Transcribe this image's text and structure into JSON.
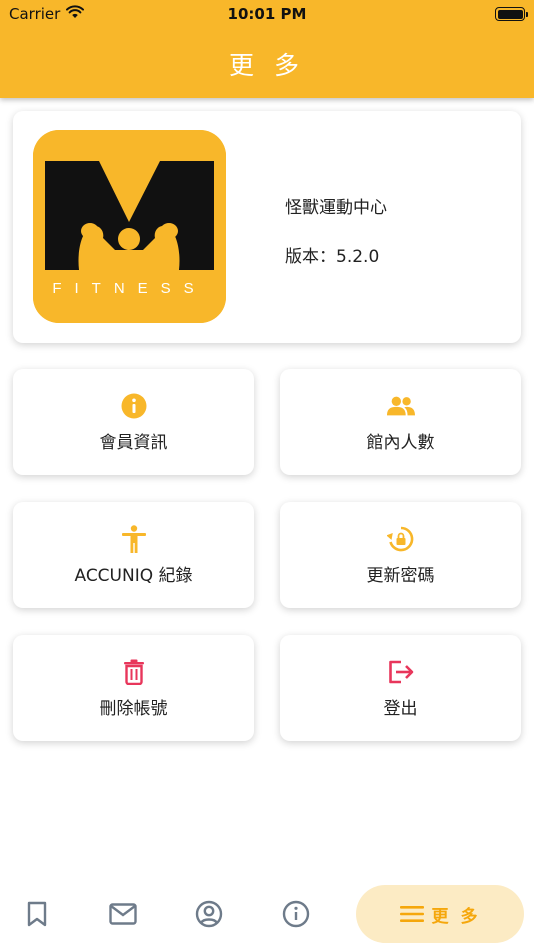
{
  "status_bar": {
    "carrier": "Carrier",
    "time": "10:01 PM"
  },
  "header": {
    "title": "更 多"
  },
  "app_info": {
    "logo_text": "FITNESS",
    "name": "怪獸運動中心",
    "version": "版本：5.2.0"
  },
  "tiles": [
    {
      "label": "會員資訊",
      "icon": "info-icon"
    },
    {
      "label": "館內人數",
      "icon": "people-icon"
    },
    {
      "label": "ACCUNIQ 紀錄",
      "icon": "accessibility-icon"
    },
    {
      "label": "更新密碼",
      "icon": "lock-reset-icon"
    },
    {
      "label": "刪除帳號",
      "icon": "trash-icon"
    },
    {
      "label": "登出",
      "icon": "logout-icon"
    }
  ],
  "tab_bar": {
    "items": [
      "bookmark-icon",
      "mail-icon",
      "account-circle-icon",
      "info-outline-icon"
    ],
    "active_label": "更 多"
  },
  "colors": {
    "accent": "#F8B72A",
    "danger": "#E8365B",
    "active_bg": "#FCEBC4"
  }
}
